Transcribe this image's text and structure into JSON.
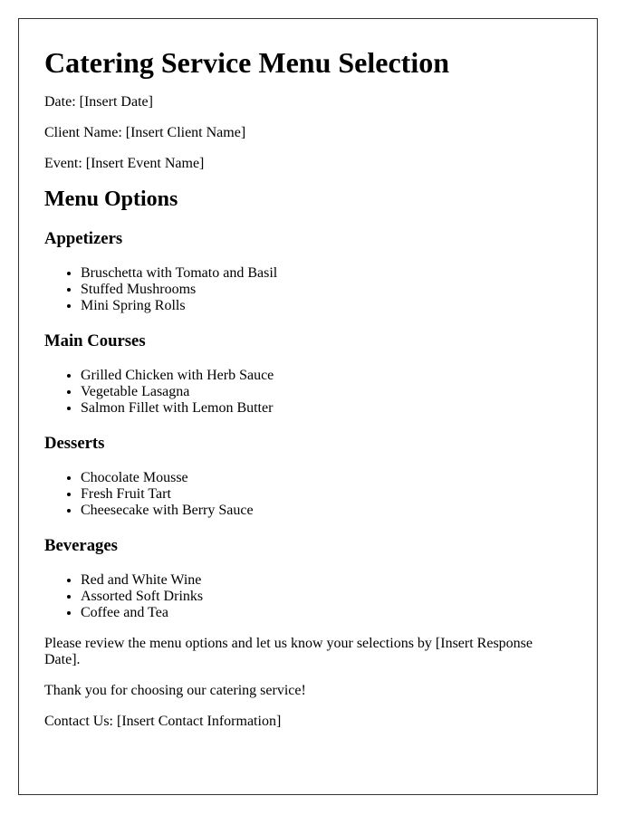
{
  "document": {
    "title": "Catering Service Menu Selection",
    "meta": [
      "Date: [Insert Date]",
      "Client Name: [Insert Client Name]",
      "Event: [Insert Event Name]"
    ],
    "menu_heading": "Menu Options",
    "sections": [
      {
        "heading": "Appetizers",
        "items": [
          "Bruschetta with Tomato and Basil",
          "Stuffed Mushrooms",
          "Mini Spring Rolls"
        ]
      },
      {
        "heading": "Main Courses",
        "items": [
          "Grilled Chicken with Herb Sauce",
          "Vegetable Lasagna",
          "Salmon Fillet with Lemon Butter"
        ]
      },
      {
        "heading": "Desserts",
        "items": [
          "Chocolate Mousse",
          "Fresh Fruit Tart",
          "Cheesecake with Berry Sauce"
        ]
      },
      {
        "heading": "Beverages",
        "items": [
          "Red and White Wine",
          "Assorted Soft Drinks",
          "Coffee and Tea"
        ]
      }
    ],
    "closing": [
      "Please review the menu options and let us know your selections by [Insert Response Date].",
      "Thank you for choosing our catering service!",
      "Contact Us: [Insert Contact Information]"
    ]
  }
}
